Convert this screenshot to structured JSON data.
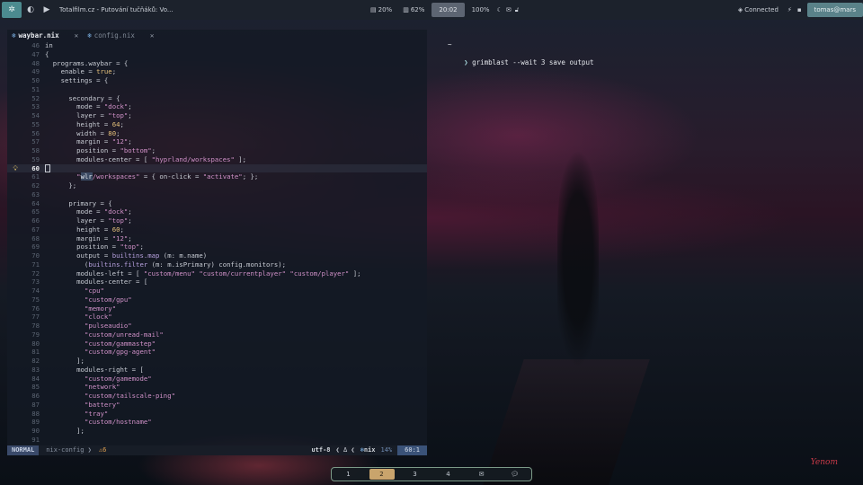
{
  "topbar": {
    "window_title": "Totalfilm.cz - Putování tučňáků: Vo...",
    "stats": [
      {
        "icon": "cpu-icon",
        "glyph": "▤",
        "value": "20%"
      },
      {
        "icon": "memory-icon",
        "glyph": "▥",
        "value": "62%"
      }
    ],
    "clock": "20:02",
    "brightness": "100%",
    "network_status": "Connected",
    "hostname": "tomas@mars"
  },
  "editor": {
    "tabs": [
      {
        "label": "waybar.nix",
        "active": true
      },
      {
        "label": "config.nix",
        "active": false
      }
    ],
    "close_glyph": "✕",
    "lines": [
      {
        "n": "46",
        "t": "in"
      },
      {
        "n": "47",
        "t": "{"
      },
      {
        "n": "48",
        "t": "  programs.waybar = {"
      },
      {
        "n": "49",
        "t": "    enable = true;"
      },
      {
        "n": "50",
        "t": "    settings = {"
      },
      {
        "n": "51",
        "t": ""
      },
      {
        "n": "52",
        "t": "      secondary = {"
      },
      {
        "n": "53",
        "t": "        mode = \"dock\";"
      },
      {
        "n": "54",
        "t": "        layer = \"top\";"
      },
      {
        "n": "55",
        "t": "        height = 64;"
      },
      {
        "n": "56",
        "t": "        width = 80;"
      },
      {
        "n": "57",
        "t": "        margin = \"12\";"
      },
      {
        "n": "58",
        "t": "        position = \"bottom\";"
      },
      {
        "n": "59",
        "t": "        modules-center = [ \"hyprland/workspaces\" ];"
      },
      {
        "n": "60",
        "t": ""
      },
      {
        "n": "61",
        "t": "        \"wlr/workspaces\" = { on-click = \"activate\"; };"
      },
      {
        "n": "62",
        "t": "      };"
      },
      {
        "n": "63",
        "t": ""
      },
      {
        "n": "64",
        "t": "      primary = {"
      },
      {
        "n": "65",
        "t": "        mode = \"dock\";"
      },
      {
        "n": "66",
        "t": "        layer = \"top\";"
      },
      {
        "n": "67",
        "t": "        height = 60;"
      },
      {
        "n": "68",
        "t": "        margin = \"12\";"
      },
      {
        "n": "69",
        "t": "        position = \"top\";"
      },
      {
        "n": "70",
        "t": "        output = builtins.map (m: m.name)"
      },
      {
        "n": "71",
        "t": "          (builtins.filter (m: m.isPrimary) config.monitors);"
      },
      {
        "n": "72",
        "t": "        modules-left = [ \"custom/menu\" \"custom/currentplayer\" \"custom/player\" ];"
      },
      {
        "n": "73",
        "t": "        modules-center = ["
      },
      {
        "n": "74",
        "t": "          \"cpu\""
      },
      {
        "n": "75",
        "t": "          \"custom/gpu\""
      },
      {
        "n": "76",
        "t": "          \"memory\""
      },
      {
        "n": "77",
        "t": "          \"clock\""
      },
      {
        "n": "78",
        "t": "          \"pulseaudio\""
      },
      {
        "n": "79",
        "t": "          \"custom/unread-mail\""
      },
      {
        "n": "80",
        "t": "          \"custom/gammastep\""
      },
      {
        "n": "81",
        "t": "          \"custom/gpg-agent\""
      },
      {
        "n": "82",
        "t": "        ];"
      },
      {
        "n": "83",
        "t": "        modules-right = ["
      },
      {
        "n": "84",
        "t": "          \"custom/gamemode\""
      },
      {
        "n": "85",
        "t": "          \"network\""
      },
      {
        "n": "86",
        "t": "          \"custom/tailscale-ping\""
      },
      {
        "n": "87",
        "t": "          \"battery\""
      },
      {
        "n": "88",
        "t": "          \"tray\""
      },
      {
        "n": "89",
        "t": "          \"custom/hostname\""
      },
      {
        "n": "90",
        "t": "        ];"
      },
      {
        "n": "91",
        "t": ""
      }
    ],
    "current_line": "60",
    "statusline": {
      "mode": "NORMAL",
      "branch": "nix-config",
      "warnings": "6",
      "encoding": "utf-8",
      "filetype": "nix",
      "percent": "14%",
      "position": "60:1"
    }
  },
  "terminal": {
    "previous_prompt": "~",
    "prompt_symbol": "❯",
    "command": "grimblast --wait 3 save output"
  },
  "workspaces": {
    "items": [
      "1",
      "2",
      "3",
      "4"
    ],
    "active": "2",
    "icons": [
      "mail-icon",
      "chat-icon"
    ]
  },
  "signature": "Yenom"
}
